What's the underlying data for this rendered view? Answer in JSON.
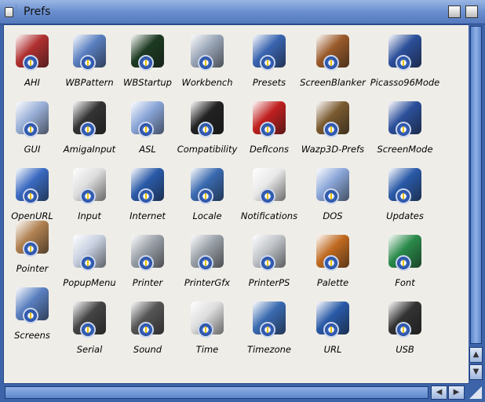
{
  "window": {
    "title": "Prefs"
  },
  "items": [
    {
      "label": "AHI",
      "color": "#b03030"
    },
    {
      "label": "WBPattern",
      "color": "#5a7fc0"
    },
    {
      "label": "WBStartup",
      "color": "#1d3a22"
    },
    {
      "label": "Workbench",
      "color": "#9aa6b8"
    },
    {
      "label": "Presets",
      "color": "#3a64b0"
    },
    {
      "label": "ScreenBlanker",
      "color": "#9a5a2a"
    },
    {
      "label": "Picasso96Mode",
      "color": "#2c4f9a"
    },
    {
      "label": "GUI",
      "color": "#9ab0d8"
    },
    {
      "label": "AmigaInput",
      "color": "#333333"
    },
    {
      "label": "ASL",
      "color": "#8aa6d8"
    },
    {
      "label": "Compatibility",
      "color": "#222222"
    },
    {
      "label": "DefIcons",
      "color": "#c02020"
    },
    {
      "label": "Wazp3D-Prefs",
      "color": "#7a5a30"
    },
    {
      "label": "ScreenMode",
      "color": "#2c4f9a"
    },
    {
      "label": "OpenURL",
      "color": "#3a6ac0"
    },
    {
      "label": "Input",
      "color": "#dddddd"
    },
    {
      "label": "Internet",
      "color": "#2a5aa8"
    },
    {
      "label": "Locale",
      "color": "#3a6ab0"
    },
    {
      "label": "Notifications",
      "color": "#e8e8e8"
    },
    {
      "label": "DOS",
      "color": "#8aa6d8"
    },
    {
      "label": "Updates",
      "color": "#2a5aa8"
    },
    {
      "label": "Pointer",
      "color": "#b08050"
    },
    {
      "label": "PopupMenu",
      "color": "#c8d0e0"
    },
    {
      "label": "Printer",
      "color": "#9aa0a8"
    },
    {
      "label": "PrinterGfx",
      "color": "#9aa0a8"
    },
    {
      "label": "PrinterPS",
      "color": "#c0c4c8"
    },
    {
      "label": "Palette",
      "color": "#c06a20"
    },
    {
      "label": "Font",
      "color": "#2a8a4a"
    },
    {
      "label": "Screens",
      "color": "#5a7fc0"
    },
    {
      "label": "Serial",
      "color": "#444444"
    },
    {
      "label": "Sound",
      "color": "#555555"
    },
    {
      "label": "Time",
      "color": "#dddddd"
    },
    {
      "label": "Timezone",
      "color": "#3a6ab0"
    },
    {
      "label": "URL",
      "color": "#2a5aa8"
    },
    {
      "label": "USB",
      "color": "#333333"
    }
  ]
}
